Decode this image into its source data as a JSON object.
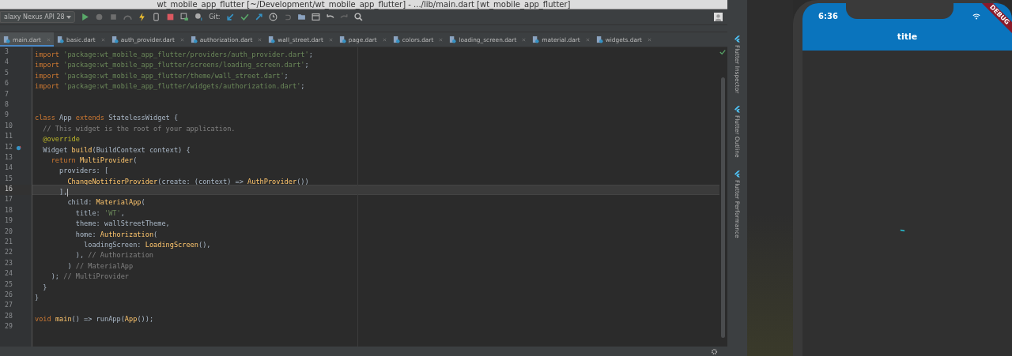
{
  "window": {
    "title": "wt_mobile_app_flutter [~/Development/wt_mobile_app_flutter] - .../lib/main.dart [wt_mobile_app_flutter]"
  },
  "toolbar": {
    "device": "alaxy Nexus API 28",
    "git_label": "Git:"
  },
  "tabs": [
    {
      "label": "main.dart",
      "selected": true
    },
    {
      "label": "basic.dart",
      "selected": false
    },
    {
      "label": "auth_provider.dart",
      "selected": false
    },
    {
      "label": "authorization.dart",
      "selected": false
    },
    {
      "label": "wall_street.dart",
      "selected": false
    },
    {
      "label": "page.dart",
      "selected": false
    },
    {
      "label": "colors.dart",
      "selected": false
    },
    {
      "label": "loading_screen.dart",
      "selected": false
    },
    {
      "label": "material.dart",
      "selected": false
    },
    {
      "label": "widgets.dart",
      "selected": false
    }
  ],
  "editor": {
    "lines": [
      {
        "number": "3",
        "current": false,
        "tokens": [
          {
            "kind": "keyword",
            "text": "import "
          },
          {
            "kind": "string",
            "text": "'package:wt_mobile_app_flutter/providers/auth_provider.dart'"
          },
          {
            "kind": "plain",
            "text": ";"
          }
        ]
      },
      {
        "number": "4",
        "current": false,
        "tokens": [
          {
            "kind": "keyword",
            "text": "import "
          },
          {
            "kind": "string",
            "text": "'package:wt_mobile_app_flutter/screens/loading_screen.dart'"
          },
          {
            "kind": "plain",
            "text": ";"
          }
        ]
      },
      {
        "number": "5",
        "current": false,
        "tokens": [
          {
            "kind": "keyword",
            "text": "import "
          },
          {
            "kind": "string",
            "text": "'package:wt_mobile_app_flutter/theme/wall_street.dart'"
          },
          {
            "kind": "plain",
            "text": ";"
          }
        ]
      },
      {
        "number": "6",
        "current": false,
        "tokens": [
          {
            "kind": "keyword",
            "text": "import "
          },
          {
            "kind": "string",
            "text": "'package:wt_mobile_app_flutter/widgets/authorization.dart'"
          },
          {
            "kind": "plain",
            "text": ";"
          }
        ]
      },
      {
        "number": "7",
        "current": false
      },
      {
        "number": "8",
        "current": false
      },
      {
        "number": "9",
        "current": false,
        "tokens": [
          {
            "kind": "keyword",
            "text": "class "
          },
          {
            "kind": "plain",
            "text": "App "
          },
          {
            "kind": "keyword",
            "text": "extends "
          },
          {
            "kind": "plain",
            "text": "StatelessWidget {"
          }
        ]
      },
      {
        "number": "10",
        "current": false,
        "tokens": [
          {
            "kind": "comment",
            "text": "  // This widget is the root of your application."
          }
        ]
      },
      {
        "number": "11",
        "current": false,
        "tokens": [
          {
            "kind": "annotation",
            "text": "  @override"
          }
        ]
      },
      {
        "number": "12",
        "current": false,
        "marker": true,
        "tokens": [
          {
            "kind": "plain",
            "text": "  Widget "
          },
          {
            "kind": "call",
            "text": "build"
          },
          {
            "kind": "plain",
            "text": "(BuildContext context) {"
          }
        ]
      },
      {
        "number": "13",
        "current": false,
        "tokens": [
          {
            "kind": "keyword",
            "text": "    return "
          },
          {
            "kind": "call",
            "text": "MultiProvider"
          },
          {
            "kind": "plain",
            "text": "("
          }
        ]
      },
      {
        "number": "14",
        "current": false,
        "tokens": [
          {
            "kind": "plain",
            "text": "      providers: ["
          }
        ]
      },
      {
        "number": "15",
        "current": false,
        "tokens": [
          {
            "kind": "call",
            "text": "        ChangeNotifierProvider"
          },
          {
            "kind": "plain",
            "text": "(create: (context) => "
          },
          {
            "kind": "call",
            "text": "AuthProvider"
          },
          {
            "kind": "plain",
            "text": "())"
          }
        ]
      },
      {
        "number": "16",
        "current": true,
        "tokens": [
          {
            "kind": "plain",
            "text": "      ],"
          }
        ]
      },
      {
        "number": "17",
        "current": false,
        "tokens": [
          {
            "kind": "plain",
            "text": "        child: "
          },
          {
            "kind": "call",
            "text": "MaterialApp"
          },
          {
            "kind": "plain",
            "text": "("
          }
        ]
      },
      {
        "number": "18",
        "current": false,
        "tokens": [
          {
            "kind": "plain",
            "text": "          title: "
          },
          {
            "kind": "string",
            "text": "'WT'"
          },
          {
            "kind": "plain",
            "text": ","
          }
        ]
      },
      {
        "number": "19",
        "current": false,
        "tokens": [
          {
            "kind": "plain",
            "text": "          theme: wallStreetTheme,"
          }
        ]
      },
      {
        "number": "20",
        "current": false,
        "tokens": [
          {
            "kind": "plain",
            "text": "          home: "
          },
          {
            "kind": "call",
            "text": "Authorization"
          },
          {
            "kind": "plain",
            "text": "("
          }
        ]
      },
      {
        "number": "21",
        "current": false,
        "tokens": [
          {
            "kind": "plain",
            "text": "            loadingScreen: "
          },
          {
            "kind": "call",
            "text": "LoadingScreen"
          },
          {
            "kind": "plain",
            "text": "(),"
          }
        ]
      },
      {
        "number": "22",
        "current": false,
        "tokens": [
          {
            "kind": "plain",
            "text": "          ), "
          },
          {
            "kind": "comment",
            "text": "// Authorization"
          }
        ]
      },
      {
        "number": "23",
        "current": false,
        "tokens": [
          {
            "kind": "plain",
            "text": "        ) "
          },
          {
            "kind": "comment",
            "text": "// MaterialApp"
          }
        ]
      },
      {
        "number": "24",
        "current": false,
        "tokens": [
          {
            "kind": "plain",
            "text": "    ); "
          },
          {
            "kind": "comment",
            "text": "// MultiProvider"
          }
        ]
      },
      {
        "number": "25",
        "current": false,
        "tokens": [
          {
            "kind": "plain",
            "text": "  }"
          }
        ]
      },
      {
        "number": "26",
        "current": false,
        "tokens": [
          {
            "kind": "plain",
            "text": "}"
          }
        ]
      },
      {
        "number": "27",
        "current": false
      },
      {
        "number": "28",
        "current": false,
        "tokens": [
          {
            "kind": "keyword",
            "text": "void "
          },
          {
            "kind": "call",
            "text": "main"
          },
          {
            "kind": "plain",
            "text": "() => runApp("
          },
          {
            "kind": "call",
            "text": "App"
          },
          {
            "kind": "plain",
            "text": "());"
          }
        ]
      },
      {
        "number": "29",
        "current": false
      }
    ]
  },
  "tool_windows": [
    "Flutter Inspector",
    "Flutter Outline",
    "Flutter Performance"
  ],
  "phone": {
    "time": "6:36",
    "app_title": "title",
    "banner": "DEBUG"
  }
}
